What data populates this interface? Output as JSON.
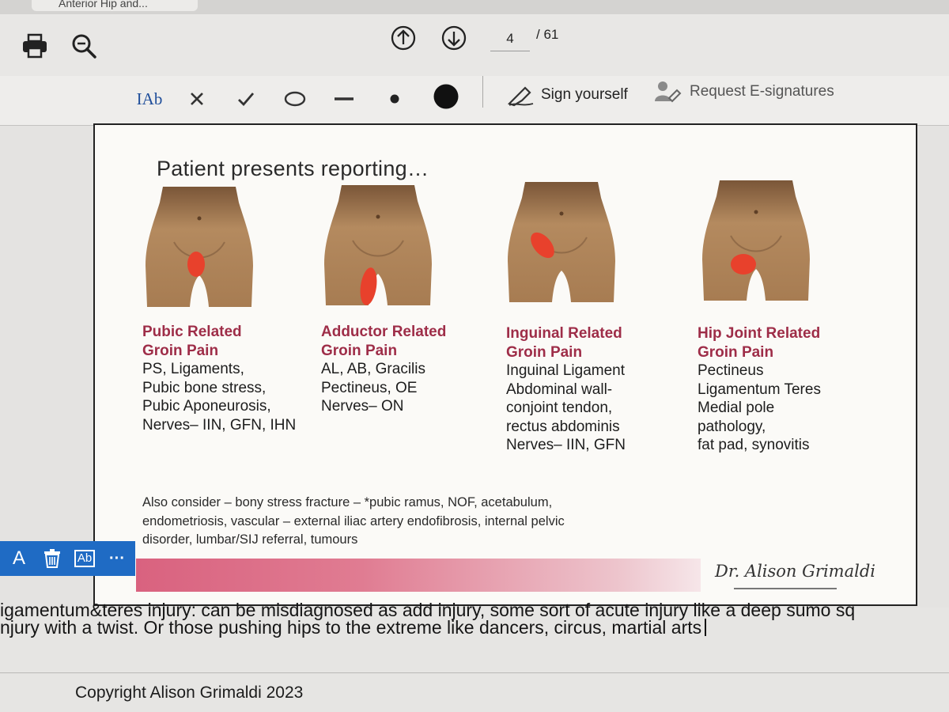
{
  "tab": {
    "title": "Anterior Hip and..."
  },
  "toolbar": {
    "page_current": "4",
    "page_total": "/ 61"
  },
  "signbar": {
    "sign_yourself": "Sign yourself",
    "request_esignatures": "Request E-signatures",
    "text_tool_label": "IAb"
  },
  "slide": {
    "title": "Patient presents reporting…",
    "columns": [
      {
        "heading": [
          "Pubic Related",
          "Groin Pain"
        ],
        "items": [
          "PS, Ligaments,",
          "Pubic bone stress,",
          "Pubic Aponeurosis,",
          "Nerves– IIN, GFN, IHN"
        ]
      },
      {
        "heading": [
          "Adductor Related",
          "Groin Pain"
        ],
        "items": [
          "AL, AB, Gracilis",
          "Pectineus, OE",
          "Nerves– ON"
        ]
      },
      {
        "heading": [
          "Inguinal Related",
          "Groin Pain"
        ],
        "items": [
          "Inguinal Ligament",
          "Abdominal wall-",
          "conjoint tendon,",
          "rectus abdominis",
          "Nerves– IIN, GFN"
        ]
      },
      {
        "heading": [
          "Hip Joint Related",
          "Groin Pain"
        ],
        "items": [
          "Pectineus",
          "Ligamentum Teres",
          "Medial pole",
          "pathology,",
          "fat pad, synovitis"
        ]
      }
    ],
    "also_consider": [
      "Also consider – bony stress fracture – *pubic ramus, NOF, acetabulum,",
      "endometriosis, vascular – external iliac artery endofibrosis, internal pelvic",
      "disorder, lumbar/SIJ referral, tumours"
    ],
    "signature": "Dr. Alison Grimaldi"
  },
  "annotation_toolbar": {
    "text_label": "A",
    "textbox_label": "Ab",
    "more_label": "···"
  },
  "notes": {
    "line1": "igamentum&teres injury: can be misdiagnosed as add injury, some sort of acute injury like a deep sumo sq",
    "line2": "njury with a twist. Or those pushing hips to the extreme like dancers, circus, martial arts",
    "copyright": "Copyright Alison Grimaldi 2023"
  },
  "colors": {
    "heading": "#9e2d48",
    "pain_marker": "#e8412c",
    "accent_blue": "#1f6bc4",
    "skin": "#b0865c"
  },
  "icons": [
    "print-icon",
    "zoom-icon",
    "arrow-up-circle-icon",
    "arrow-down-circle-icon",
    "cross-icon",
    "check-icon",
    "circle-icon",
    "line-icon",
    "small-dot-icon",
    "large-dot-icon",
    "sign-pen-icon",
    "request-signatures-icon",
    "trash-icon",
    "textbox-icon",
    "more-icon"
  ]
}
